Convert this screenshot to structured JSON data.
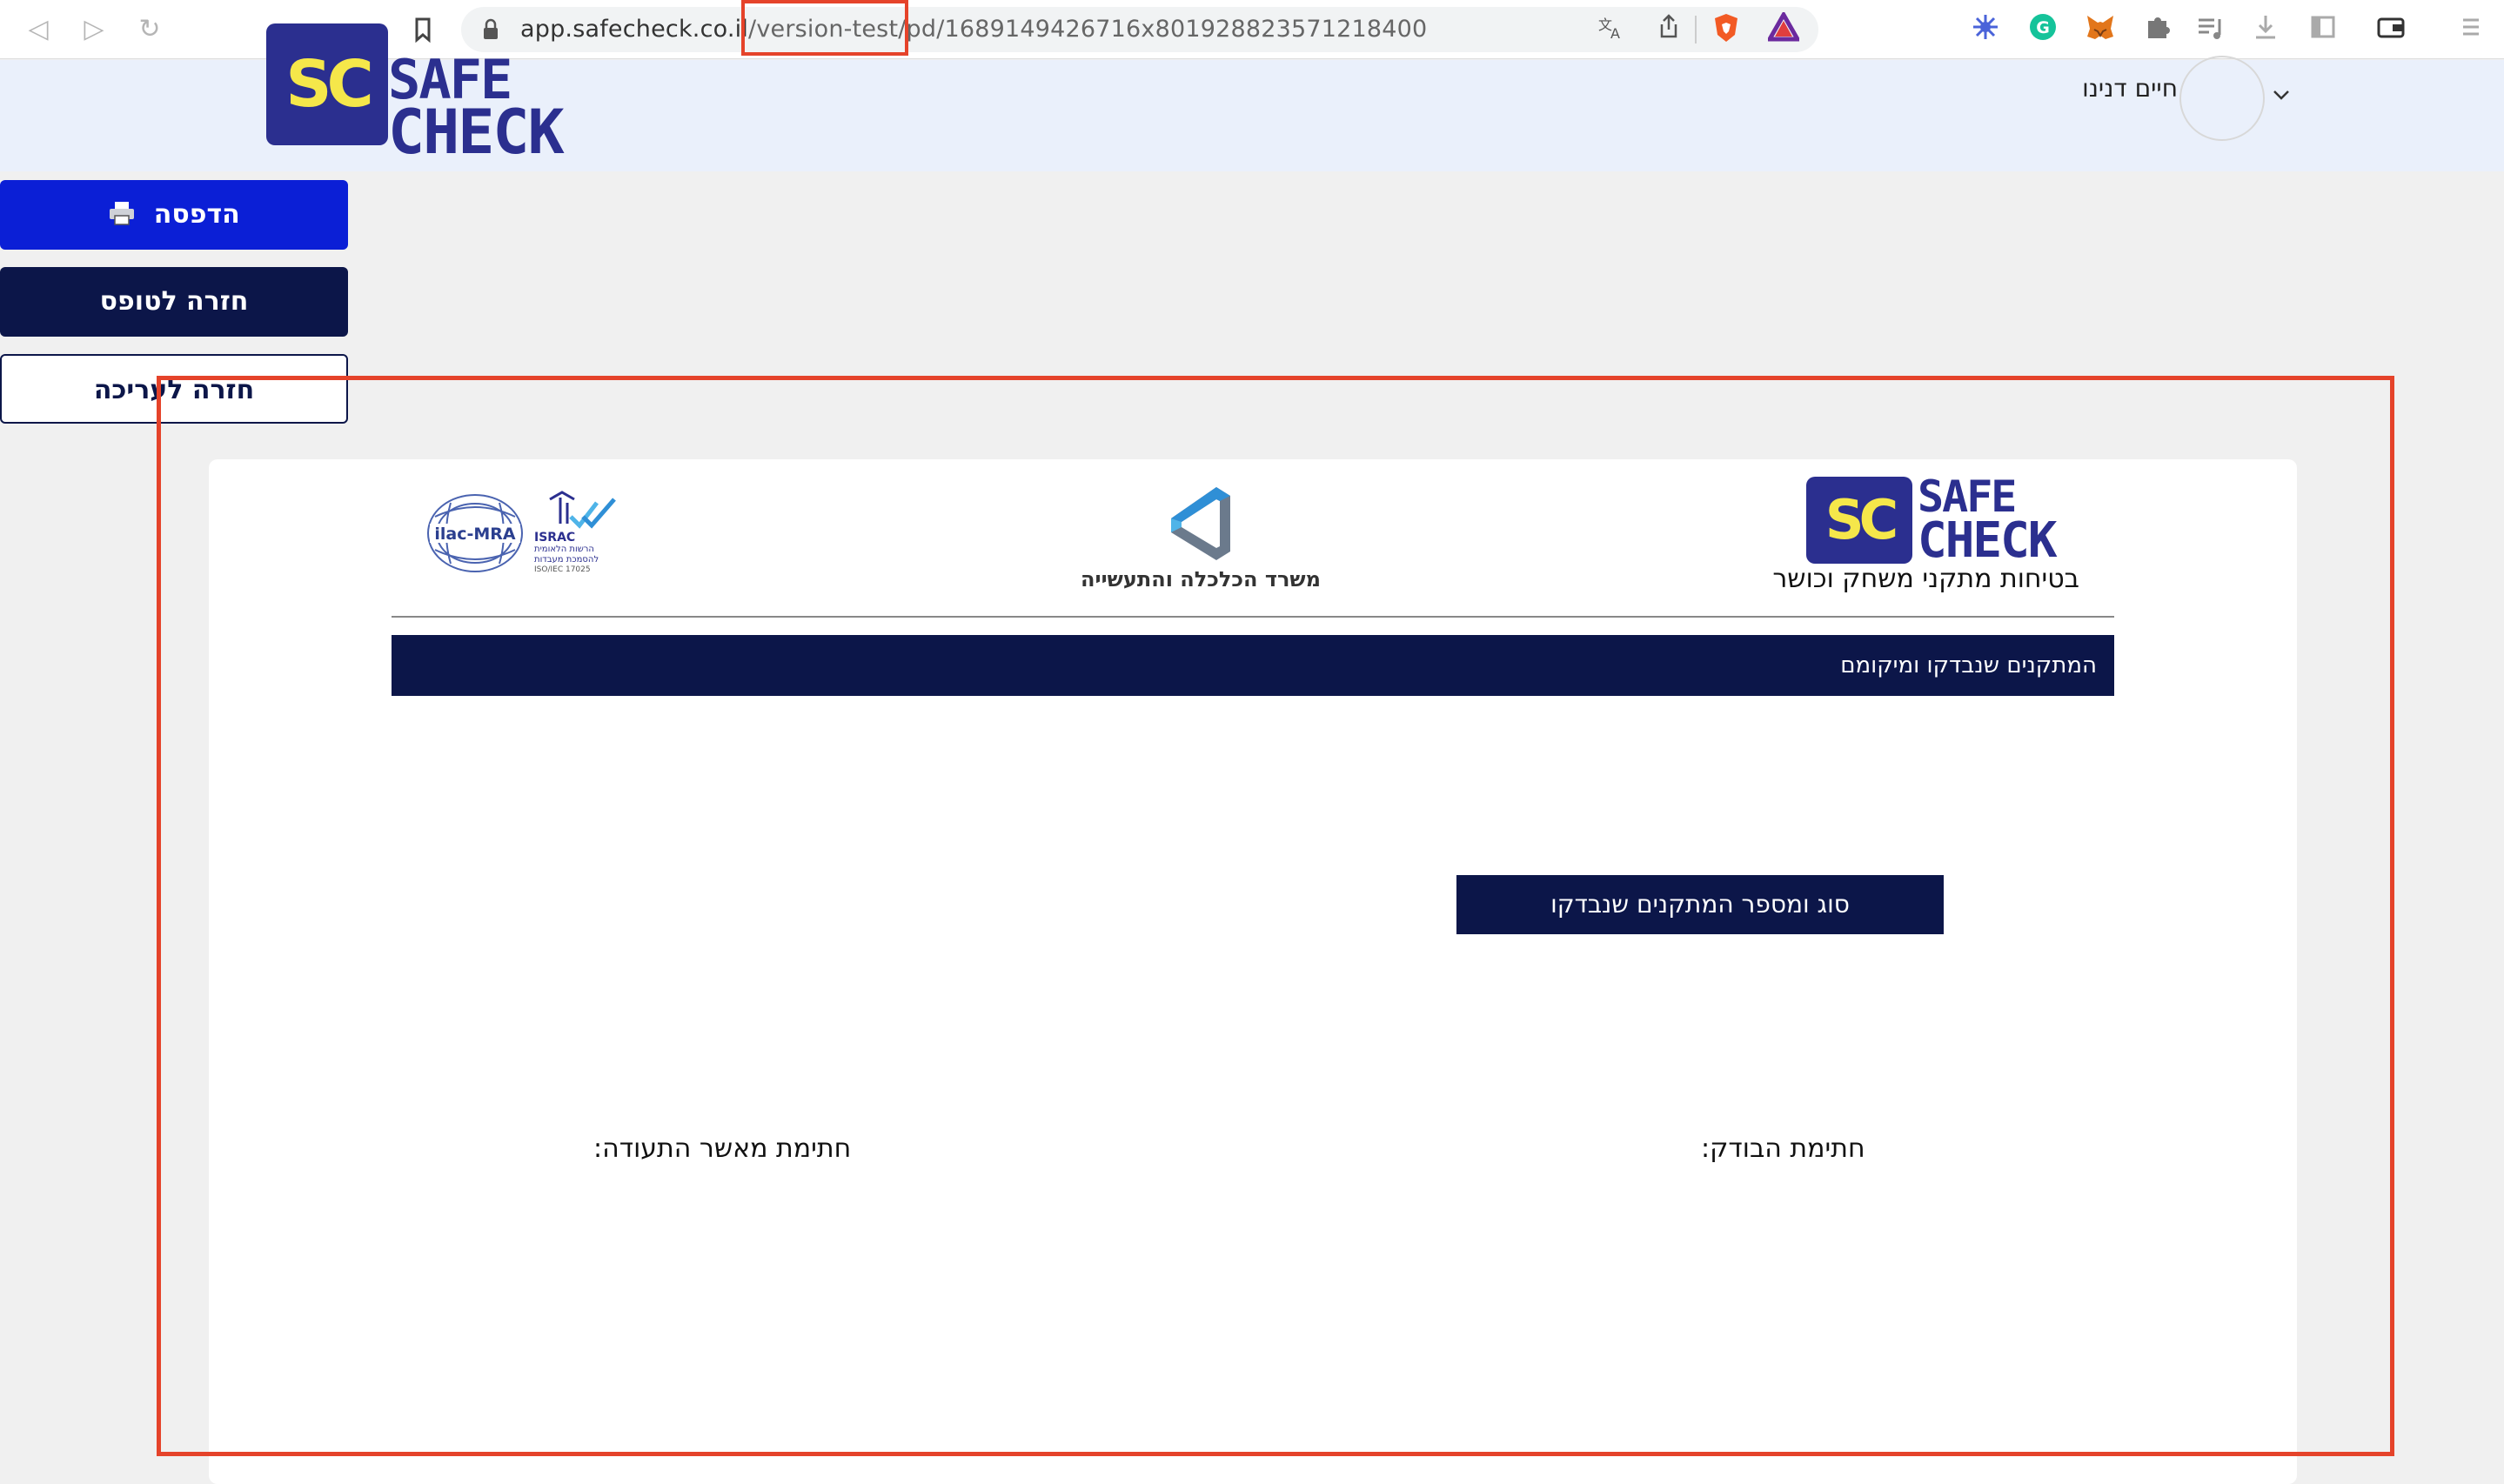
{
  "browser": {
    "url_host": "app.safecheck.co.il",
    "url_path": "/version-test/pd/1689149426716x801928823571218400",
    "icons": [
      "back-icon",
      "forward-icon",
      "reload-icon",
      "bookmark-icon",
      "lock-icon",
      "translate-icon",
      "share-icon",
      "brave-shield-icon",
      "brave-rewards-icon",
      "extension-icon",
      "grammarly-icon",
      "metamask-icon",
      "puzzle-icon",
      "media-icon",
      "download-icon",
      "sidebar-icon",
      "wallet-icon",
      "menu-icon"
    ]
  },
  "header": {
    "logo_sc": "SC",
    "logo_line1": "SAFE",
    "logo_line2": "CHECK",
    "user_name": "חיים דנינו"
  },
  "sidebar": {
    "print_label": "הדפסה",
    "back_to_form_label": "חזרה לטופס",
    "back_to_edit_label": "חזרה לעריכה"
  },
  "document": {
    "logo_sc": "SC",
    "logo_line1": "SAFE",
    "logo_line2": "CHECK",
    "tagline": "בטיחות מתקני משחק וכושר",
    "ministry_label": "משרד הכלכלה והתעשייה",
    "ilac_label": "ilac-MRA",
    "israc_label": "ISRAC",
    "israc_sub1": "הרשות הלאומית",
    "israc_sub2": "להסמכת מעבדות",
    "israc_iso": "ISO/IEC 17025",
    "section_title": "המתקנים שנבדקו ומיקומם",
    "types_title": "סוג ומספר המתקנים שנבדקו",
    "inspector_signature": "חתימת הבודק:",
    "approver_signature": "חתימת מאשר התעודה:"
  },
  "colors": {
    "brand_navy": "#0c1649",
    "brand_indigo": "#2b2f8f",
    "brand_yellow": "#f5e74a",
    "print_blue": "#0b1fd6",
    "highlight_red": "#e5432a"
  }
}
